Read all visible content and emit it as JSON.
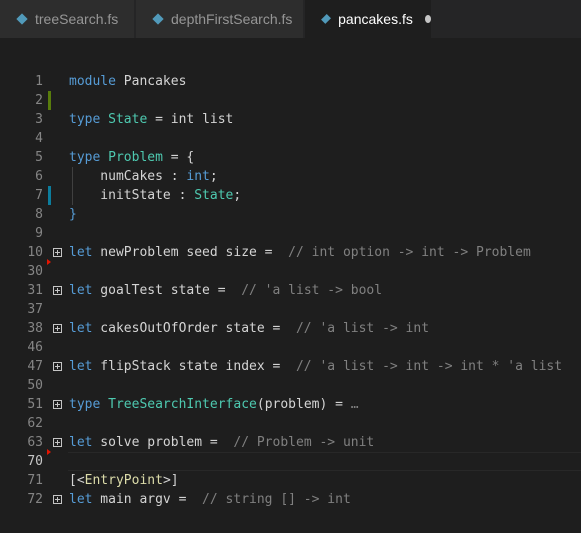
{
  "tabs": [
    {
      "label": "treeSearch.fs",
      "active": false
    },
    {
      "label": "depthFirstSearch.fs",
      "active": false
    },
    {
      "label": "pancakes.fs",
      "active": true,
      "dirty": true
    }
  ],
  "colors": {
    "keyword": "#569cd6",
    "type": "#4ec9b0",
    "comment": "#808080",
    "attribute": "#dcdcaa",
    "gutter_added": "#587c0c",
    "gutter_modified": "#0c7d9d"
  },
  "lines": [
    {
      "num": "1",
      "tokens": [
        [
          "k",
          "module"
        ],
        [
          "n",
          " Pancakes"
        ]
      ]
    },
    {
      "num": "2",
      "tokens": [],
      "gutter": "added"
    },
    {
      "num": "3",
      "tokens": [
        [
          "k",
          "type"
        ],
        [
          "n",
          " "
        ],
        [
          "t",
          "State"
        ],
        [
          "o",
          " = "
        ],
        [
          "n",
          "int list"
        ]
      ]
    },
    {
      "num": "4",
      "tokens": []
    },
    {
      "num": "5",
      "tokens": [
        [
          "k",
          "type"
        ],
        [
          "n",
          " "
        ],
        [
          "t",
          "Problem"
        ],
        [
          "o",
          " = {"
        ]
      ]
    },
    {
      "num": "6",
      "tokens": [
        [
          "n",
          "    numCakes "
        ],
        [
          "o",
          ": "
        ],
        [
          "k",
          "int"
        ],
        [
          "o",
          ";"
        ]
      ],
      "guide": true
    },
    {
      "num": "7",
      "tokens": [
        [
          "n",
          "    initState "
        ],
        [
          "o",
          ": "
        ],
        [
          "t",
          "State"
        ],
        [
          "o",
          ";"
        ]
      ],
      "guide": true,
      "gutter": "modified"
    },
    {
      "num": "8",
      "tokens": [
        [
          "k",
          "}"
        ]
      ]
    },
    {
      "num": "9",
      "tokens": []
    },
    {
      "num": "10",
      "tokens": [
        [
          "k",
          "let"
        ],
        [
          "n",
          " newProblem seed size "
        ],
        [
          "o",
          "= "
        ],
        [
          "cm",
          " // int option -> int -> Problem"
        ]
      ],
      "fold": true
    },
    {
      "num": "30",
      "tokens": [],
      "folded": true
    },
    {
      "num": "31",
      "tokens": [
        [
          "k",
          "let"
        ],
        [
          "n",
          " goalTest state "
        ],
        [
          "o",
          "= "
        ],
        [
          "cm",
          " // 'a list -> bool"
        ]
      ],
      "fold": true
    },
    {
      "num": "37",
      "tokens": []
    },
    {
      "num": "38",
      "tokens": [
        [
          "k",
          "let"
        ],
        [
          "n",
          " cakesOutOfOrder state "
        ],
        [
          "o",
          "= "
        ],
        [
          "cm",
          " // 'a list -> int"
        ]
      ],
      "fold": true
    },
    {
      "num": "46",
      "tokens": []
    },
    {
      "num": "47",
      "tokens": [
        [
          "k",
          "let"
        ],
        [
          "n",
          " flipStack state index "
        ],
        [
          "o",
          "= "
        ],
        [
          "cm",
          " // 'a list -> int -> int * 'a list"
        ]
      ],
      "fold": true
    },
    {
      "num": "50",
      "tokens": []
    },
    {
      "num": "51",
      "tokens": [
        [
          "k",
          "type"
        ],
        [
          "n",
          " "
        ],
        [
          "t",
          "TreeSearchInterface"
        ],
        [
          "o",
          "("
        ],
        [
          "n",
          "problem"
        ],
        [
          "o",
          ") = "
        ],
        [
          "ell",
          "…"
        ]
      ],
      "fold": true
    },
    {
      "num": "62",
      "tokens": []
    },
    {
      "num": "63",
      "tokens": [
        [
          "k",
          "let"
        ],
        [
          "n",
          " solve problem "
        ],
        [
          "o",
          "= "
        ],
        [
          "cm",
          " // Problem -> unit"
        ]
      ],
      "fold": true
    },
    {
      "num": "70",
      "tokens": [],
      "current": true,
      "folded": true
    },
    {
      "num": "71",
      "tokens": [
        [
          "o",
          "[<"
        ],
        [
          "a",
          "EntryPoint"
        ],
        [
          "o",
          ">]"
        ]
      ]
    },
    {
      "num": "72",
      "tokens": [
        [
          "k",
          "let"
        ],
        [
          "n",
          " main argv "
        ],
        [
          "o",
          "= "
        ],
        [
          "cm",
          " // string [] -> int"
        ]
      ],
      "fold": true
    }
  ]
}
